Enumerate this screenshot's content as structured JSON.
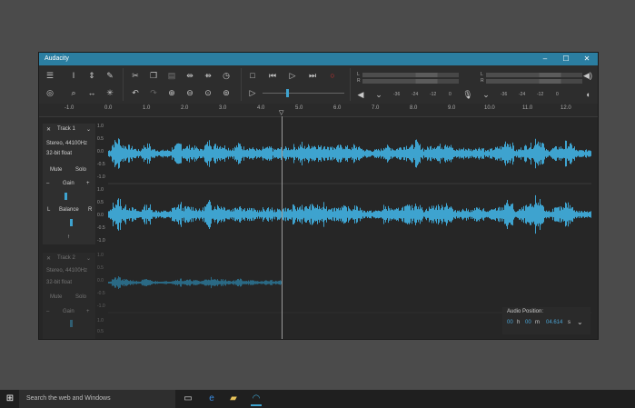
{
  "window": {
    "title": "Audacity",
    "min": "–",
    "max": "☐",
    "close": "✕"
  },
  "toolbar": {
    "icons": [
      "menu-icon",
      "select-tool-icon",
      "envelope-tool-icon",
      "draw-tool-icon",
      "cut-icon",
      "copy-icon",
      "paste-icon",
      "trim-icon",
      "silence-icon",
      "sync-icon",
      "record-level-icon",
      "zoom-tool-icon",
      "timeshift-icon",
      "multi-tool-icon",
      "undo-icon",
      "redo-icon",
      "zoom-in-icon",
      "zoom-out-icon",
      "fit-selection-icon",
      "fit-project-icon",
      "stop-icon",
      "skip-start-icon",
      "play-icon",
      "skip-end-icon",
      "record-icon",
      "play-at-speed-icon"
    ],
    "meter_scale": [
      "-36",
      "-24",
      "-12",
      "0"
    ],
    "meter_channels": [
      "L",
      "R"
    ]
  },
  "ruler": {
    "ticks": [
      "-1.0",
      "0.0",
      "1.0",
      "2.0",
      "3.0",
      "4.0",
      "5.0",
      "6.0",
      "7.0",
      "8.0",
      "9.0",
      "10.0",
      "11.0",
      "12.0"
    ]
  },
  "track1": {
    "name": "Track 1",
    "info1": "Stereo, 44100Hz",
    "info2": "32-bit float",
    "mute": "Mute",
    "solo": "Solo",
    "gain_minus": "–",
    "gain_label": "Gain",
    "gain_plus": "+",
    "bal_left": "L",
    "bal_label": "Balance",
    "bal_right": "R",
    "collapse": "↑",
    "yaxis_top": [
      "1.0",
      "0.5",
      "0.0",
      "-0.5",
      "-1.0"
    ],
    "yaxis_bottom": [
      "1.0",
      "0.5",
      "0.0",
      "-0.5",
      "-1.0"
    ]
  },
  "track2": {
    "name": "Track 2",
    "info1": "Stereo, 44100Hz",
    "info2": "32-bit float",
    "mute": "Mute",
    "solo": "Solo",
    "gain_minus": "–",
    "gain_label": "Gain",
    "gain_plus": "+",
    "yaxis_top": [
      "1.0",
      "0.5",
      "0.0",
      "-0.5",
      "-1.0"
    ],
    "yaxis_bottom": [
      "1.0",
      "0.5"
    ]
  },
  "audio_position": {
    "label": "Audio Position:",
    "h_val": "00",
    "h_unit": "h",
    "m_val": "00",
    "m_unit": "m",
    "s_val": "04.614",
    "s_unit": "s"
  },
  "taskbar": {
    "search": "Search the web and Windows"
  },
  "colors": {
    "accent": "#2b7ea1",
    "wave": "#3ea3cf",
    "wave_dim": "#2b7a9c"
  }
}
